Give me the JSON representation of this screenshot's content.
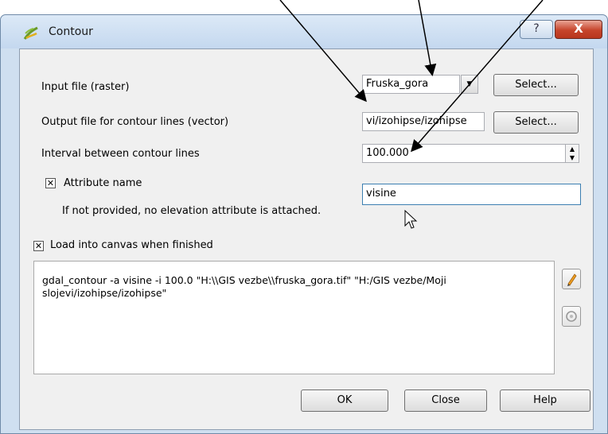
{
  "window": {
    "title": "Contour",
    "help_glyph": "?",
    "close_glyph": "X"
  },
  "input_file": {
    "label": "Input file (raster)",
    "value": "Fruska_gora",
    "select_label": "Select..."
  },
  "output_file": {
    "label": "Output file for contour lines (vector)",
    "value": "vi/izohipse/izohipse",
    "select_label": "Select..."
  },
  "interval": {
    "label": "Interval between contour lines",
    "value": "100.000"
  },
  "attribute": {
    "checkbox_label": "Attribute name",
    "hint": "If not provided, no elevation attribute is attached.",
    "value": "visine",
    "checked": true
  },
  "load_canvas": {
    "label": "Load into canvas when finished",
    "checked": true
  },
  "command": "gdal_contour -a visine -i 100.0 \"H:\\\\GIS vezbe\\\\fruska_gora.tif\" \"H:/GIS vezbe/Moji slojevi/izohipse/izohipse\"",
  "buttons": {
    "ok": "OK",
    "close": "Close",
    "help": "Help"
  },
  "colors": {
    "titlebar": "#c4d8ef",
    "close_button": "#c6442b",
    "client_bg": "#f0f0f0"
  }
}
